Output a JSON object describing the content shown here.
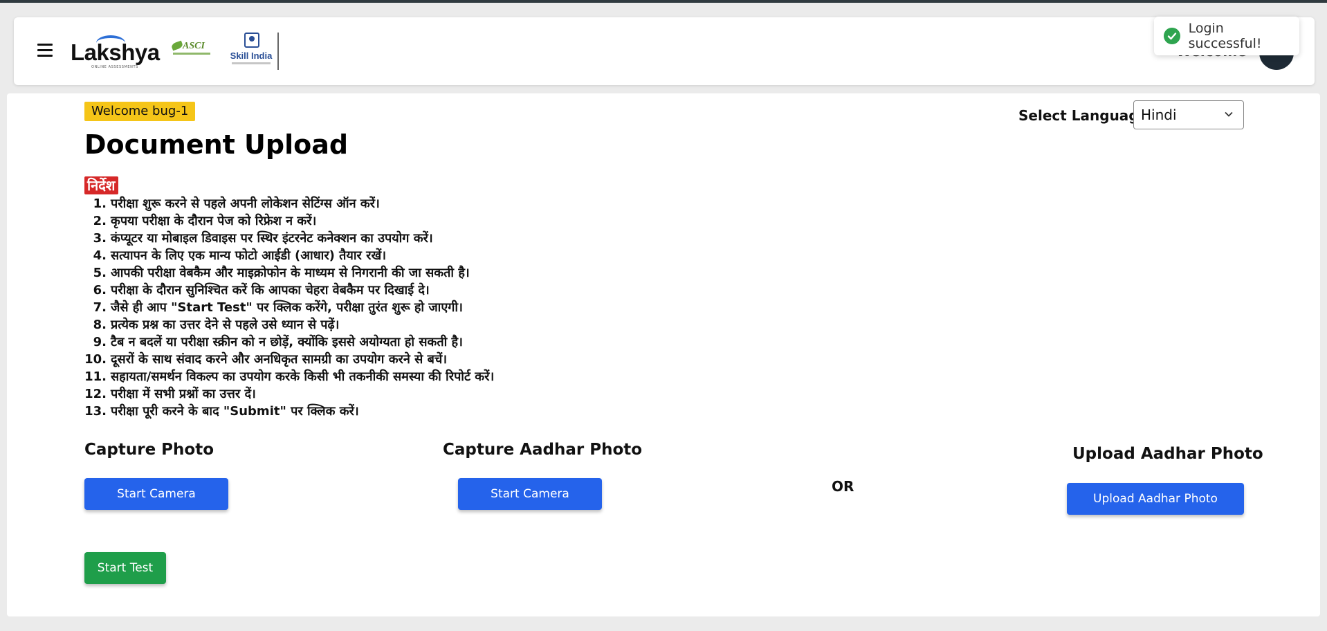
{
  "header": {
    "brand": "Lakshya",
    "brand_tagline": "ONLINE ASSESSMENTS",
    "partner_asci": "ASCI",
    "partner_skill_india": "Skill India",
    "welcome_text": "Welcome"
  },
  "toast": {
    "message": "Login successful!",
    "status_color": "#2ea44f"
  },
  "main": {
    "welcome_badge": "Welcome bug-1",
    "title": "Document Upload",
    "language_label": "Select Language:",
    "language_selected": "Hindi",
    "instructions_heading": "निर्देश",
    "instructions": [
      {
        "num": "1.",
        "text": "परीक्षा शुरू करने से पहले अपनी लोकेशन सेटिंग्स ऑन करें।"
      },
      {
        "num": "2.",
        "text": "कृपया परीक्षा के दौरान पेज को रिफ्रेश न करें।"
      },
      {
        "num": "3.",
        "text": "कंप्यूटर या मोबाइल डिवाइस पर स्थिर इंटरनेट कनेक्शन का उपयोग करें।"
      },
      {
        "num": "4.",
        "text": "सत्यापन के लिए एक मान्य फोटो आईडी (आधार) तैयार रखें।"
      },
      {
        "num": "5.",
        "text": "आपकी परीक्षा वेबकैम और माइक्रोफोन के माध्यम से निगरानी की जा सकती है।"
      },
      {
        "num": "6.",
        "text": "परीक्षा के दौरान सुनिश्चित करें कि आपका चेहरा वेबकैम पर दिखाई दे।"
      },
      {
        "num": "7.",
        "text": "जैसे ही आप \"Start Test\" पर क्लिक करेंगे, परीक्षा तुरंत शुरू हो जाएगी।"
      },
      {
        "num": "8.",
        "text": "प्रत्येक प्रश्न का उत्तर देने से पहले उसे ध्यान से पढ़ें।"
      },
      {
        "num": "9.",
        "text": "टैब न बदलें या परीक्षा स्क्रीन को न छोड़ें, क्योंकि इससे अयोग्यता हो सकती है।"
      },
      {
        "num": "10.",
        "text": "दूसरों के साथ संवाद करने और अनधिकृत सामग्री का उपयोग करने से बचें।"
      },
      {
        "num": "11.",
        "text": "सहायता/समर्थन विकल्प का उपयोग करके किसी भी तकनीकी समस्या की रिपोर्ट करें।"
      },
      {
        "num": "12.",
        "text": "परीक्षा में सभी प्रश्नों का उत्तर दें।"
      },
      {
        "num": "13.",
        "text": "परीक्षा पूरी करने के बाद \"Submit\" पर क्लिक करें।"
      }
    ],
    "capture_photo_title": "Capture Photo",
    "capture_photo_button": "Start Camera",
    "capture_aadhar_title": "Capture Aadhar Photo",
    "capture_aadhar_button": "Start Camera",
    "or_text": "OR",
    "upload_aadhar_title": "Upload Aadhar Photo",
    "upload_aadhar_button": "Upload Aadhar Photo",
    "start_test_button": "Start Test"
  },
  "colors": {
    "primary_button": "#2563eb",
    "start_test_button": "#1f9e4a",
    "welcome_badge": "#f5c518",
    "instructions_badge": "#d62828"
  }
}
